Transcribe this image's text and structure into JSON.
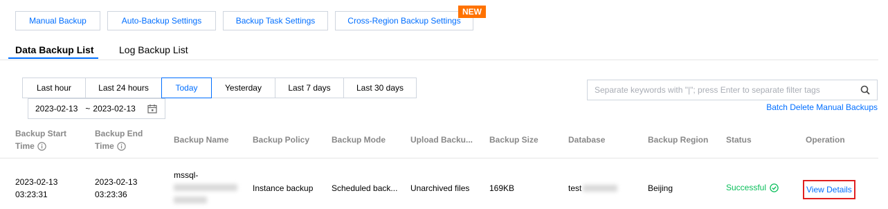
{
  "toolbar": {
    "manual_backup": "Manual Backup",
    "auto_backup": "Auto-Backup Settings",
    "backup_task": "Backup Task Settings",
    "cross_region": "Cross-Region Backup Settings",
    "new_badge": "NEW"
  },
  "tabs": [
    {
      "label": "Data Backup List",
      "active": true
    },
    {
      "label": "Log Backup List",
      "active": false
    }
  ],
  "time_filters": [
    "Last hour",
    "Last 24 hours",
    "Today",
    "Yesterday",
    "Last 7 days",
    "Last 30 days"
  ],
  "active_time_filter": "Today",
  "date_range": {
    "start": "2023-02-13",
    "separator": "~",
    "end": "2023-02-13"
  },
  "search": {
    "placeholder": "Separate keywords with \"|\"; press Enter to separate filter tags"
  },
  "batch_delete_label": "Batch Delete Manual Backups",
  "table": {
    "headers": {
      "start_time": [
        "Backup Start",
        "Time"
      ],
      "end_time": [
        "Backup End",
        "Time"
      ],
      "name": "Backup Name",
      "policy": "Backup Policy",
      "mode": "Backup Mode",
      "upload": "Upload Backu...",
      "size": "Backup Size",
      "database": "Database",
      "region": "Backup Region",
      "status": "Status",
      "operation": "Operation"
    },
    "rows": [
      {
        "start_date": "2023-02-13",
        "start_time": "03:23:31",
        "end_date": "2023-02-13",
        "end_time": "03:23:36",
        "name_prefix": "mssql-",
        "policy": "Instance backup",
        "mode": "Scheduled back...",
        "upload": "Unarchived files",
        "size": "169KB",
        "database_prefix": "test",
        "region": "Beijing",
        "status": "Successful",
        "operation": "View Details"
      }
    ]
  },
  "colors": {
    "accent": "#006eff",
    "success": "#0abf5b",
    "badge": "#ff7200",
    "highlight": "#e02020"
  }
}
